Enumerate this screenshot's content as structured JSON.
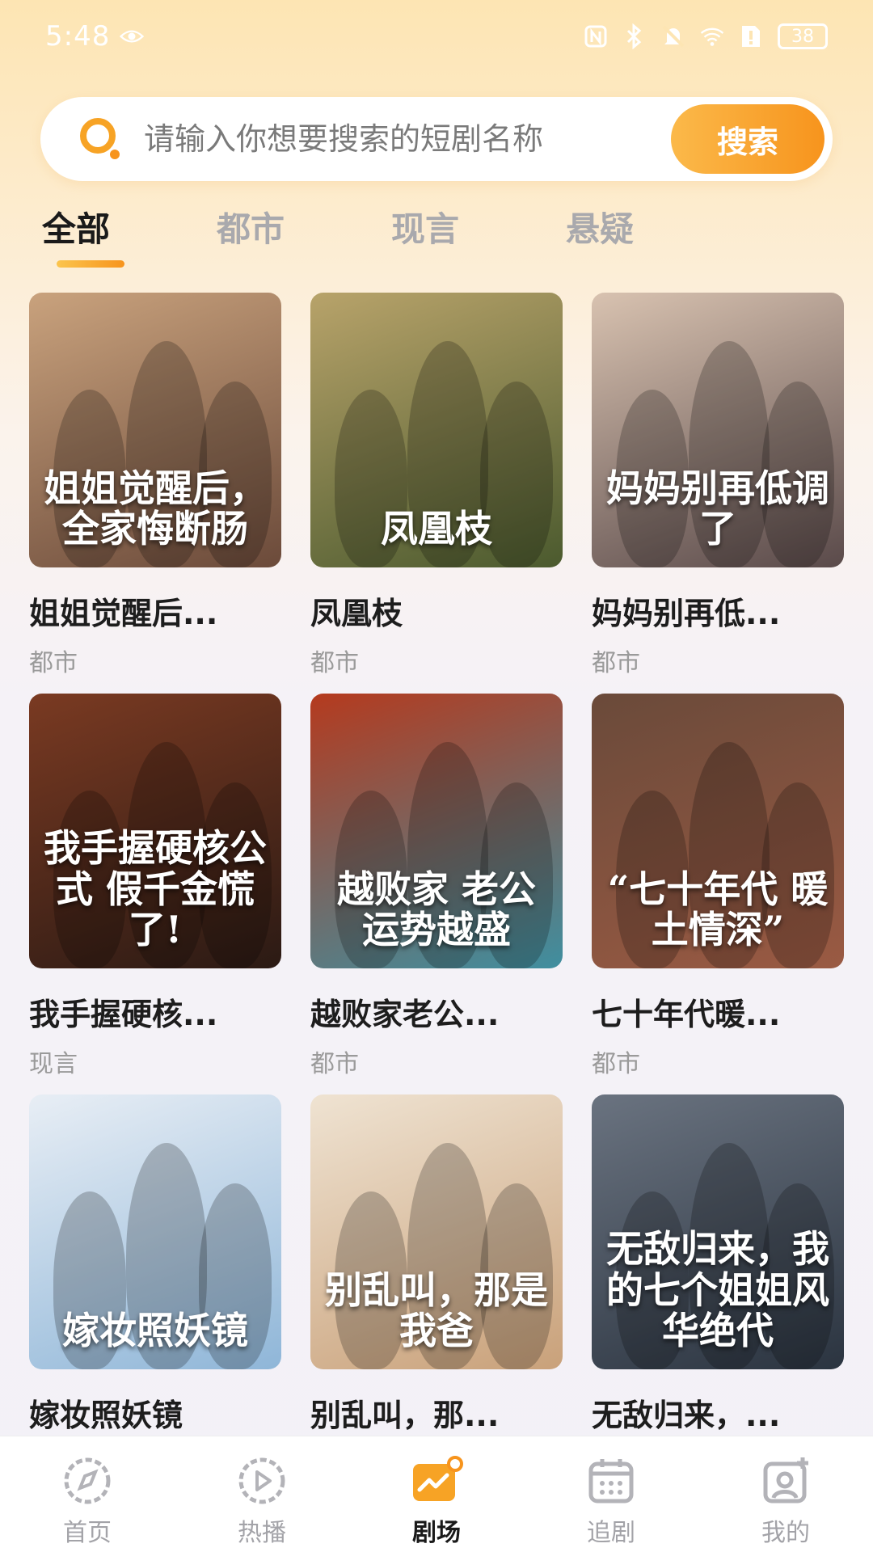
{
  "status_bar": {
    "time": "5:48",
    "battery": "38"
  },
  "search": {
    "placeholder": "请输入你想要搜索的短剧名称",
    "button_label": "搜索"
  },
  "tabs": [
    {
      "label": "全部",
      "active": true
    },
    {
      "label": "都市",
      "active": false
    },
    {
      "label": "现言",
      "active": false
    },
    {
      "label": "悬疑",
      "active": false
    }
  ],
  "dramas": [
    {
      "title": "姐姐觉醒后...",
      "genre": "都市",
      "poster_text": "姐姐觉醒后，全家悔断肠",
      "colors": [
        "#6b4a3a",
        "#c9a27d"
      ]
    },
    {
      "title": "凤凰枝",
      "genre": "都市",
      "poster_text": "凤凰枝",
      "colors": [
        "#4b5a2e",
        "#b8a36a"
      ]
    },
    {
      "title": "妈妈别再低...",
      "genre": "都市",
      "poster_text": "妈妈别再低调了",
      "colors": [
        "#5a4a4a",
        "#d8c2b0"
      ]
    },
    {
      "title": "我手握硬核...",
      "genre": "现言",
      "poster_text": "我手握硬核公式 假千金慌了!",
      "colors": [
        "#2b1a14",
        "#7a3a22"
      ]
    },
    {
      "title": "越败家老公...",
      "genre": "都市",
      "poster_text": "越败家 老公 运势越盛",
      "colors": [
        "#3f8fa0",
        "#b53a1e"
      ]
    },
    {
      "title": "七十年代暖...",
      "genre": "都市",
      "poster_text": "“七十年代 暖土情深”",
      "colors": [
        "#9a5a43",
        "#6a4a3a"
      ]
    },
    {
      "title": "嫁妆照妖镜",
      "genre": "",
      "poster_text": "嫁妆照妖镜",
      "colors": [
        "#8fb6d8",
        "#e8eef5"
      ]
    },
    {
      "title": "别乱叫，那...",
      "genre": "",
      "poster_text": "别乱叫，那是我爸",
      "colors": [
        "#c9a17a",
        "#efe3d2"
      ]
    },
    {
      "title": "无敌归来，...",
      "genre": "",
      "poster_text": "无敌归来，我的七个姐姐风华绝代",
      "colors": [
        "#2b3440",
        "#6a7380"
      ]
    }
  ],
  "bottom_nav": [
    {
      "label": "首页",
      "icon": "compass-icon",
      "active": false
    },
    {
      "label": "热播",
      "icon": "play-icon",
      "active": false
    },
    {
      "label": "剧场",
      "icon": "theater-chart-icon",
      "active": true
    },
    {
      "label": "追剧",
      "icon": "calendar-icon",
      "active": false
    },
    {
      "label": "我的",
      "icon": "profile-icon",
      "active": false
    }
  ],
  "colors": {
    "accent": "#f7941d",
    "accent_light": "#fbc54e"
  }
}
